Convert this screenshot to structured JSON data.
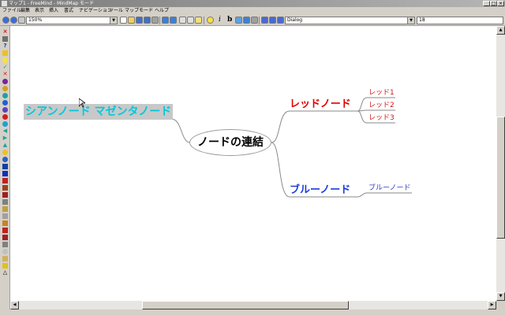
{
  "window": {
    "title": "マップ1 - FreeMind - MindMap モード",
    "buttons": [
      "_",
      "□",
      "×"
    ]
  },
  "menu": {
    "items": [
      "ファイル",
      "編集",
      "表示",
      "挿入",
      "書式",
      "ナビゲーション",
      "ツール",
      "マップ",
      "モード",
      "ヘルプ"
    ]
  },
  "toolbar": {
    "zoom_value": "150%",
    "font_name": "Dialog",
    "font_size": "18",
    "bold_label": "b",
    "italic_label": "i",
    "dropdown_glyph": "▼"
  },
  "map": {
    "root": "ノードの連結",
    "cyan_node": "シアンノード マゼンタノード",
    "red_node": "レッドノード",
    "red_children": [
      "レッド1",
      "レッド2",
      "レッド3"
    ],
    "blue_node": "ブルーノード",
    "blue_child": "ブルーノード"
  },
  "scroll_glyphs": {
    "up": "▲",
    "down": "▼",
    "left": "◀",
    "right": "▶"
  },
  "colors": {
    "cyan_text": "#00c8dc",
    "red_text": "#e00000",
    "blue_text": "#1a3cdc",
    "edge_gray": "#8a8a8a"
  }
}
